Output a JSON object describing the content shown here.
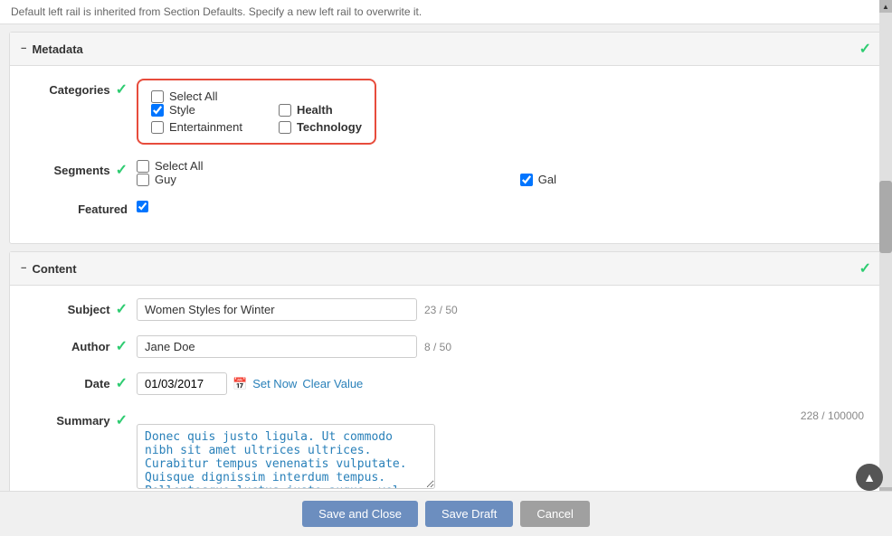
{
  "top": {
    "info_text": "Default left rail is inherited from Section Defaults. Specify a new left rail to overwrite it."
  },
  "metadata_section": {
    "title": "Metadata",
    "categories": {
      "label": "Categories",
      "options": [
        {
          "id": "select-all-cat",
          "label": "Select All",
          "checked": false,
          "fullWidth": true
        },
        {
          "id": "style",
          "label": "Style",
          "checked": true,
          "fullWidth": false
        },
        {
          "id": "health",
          "label": "Health",
          "checked": false,
          "fullWidth": false
        },
        {
          "id": "entertainment",
          "label": "Entertainment",
          "checked": false,
          "fullWidth": false
        },
        {
          "id": "technology",
          "label": "Technology",
          "checked": false,
          "fullWidth": false
        }
      ]
    },
    "segments": {
      "label": "Segments",
      "options": [
        {
          "id": "select-all-seg",
          "label": "Select All",
          "checked": false,
          "fullWidth": true
        },
        {
          "id": "guy",
          "label": "Guy",
          "checked": false,
          "fullWidth": false
        },
        {
          "id": "gal",
          "label": "Gal",
          "checked": true,
          "fullWidth": false
        }
      ]
    },
    "featured": {
      "label": "Featured",
      "checked": true
    }
  },
  "content_section": {
    "title": "Content",
    "subject": {
      "label": "Subject",
      "value": "Women Styles for Winter",
      "char_count": "23 / 50"
    },
    "author": {
      "label": "Author",
      "value": "Jane Doe",
      "char_count": "8 / 50"
    },
    "date": {
      "label": "Date",
      "value": "01/03/2017",
      "set_now": "Set Now",
      "clear_value": "Clear Value"
    },
    "summary": {
      "label": "Summary",
      "char_count": "228 / 100000",
      "value": "Donec quis justo ligula. Ut commodo nibh sit amet ultrices ultrices. Curabitur tempus venenatis vulputate. Quisque dignissim interdum tempus. Pellentesque luctus justo augue, vel gravida orci rutrum a. Sed elementum est sapien."
    }
  },
  "footer": {
    "save_close": "Save and Close",
    "save_draft": "Save Draft",
    "cancel": "Cancel"
  }
}
